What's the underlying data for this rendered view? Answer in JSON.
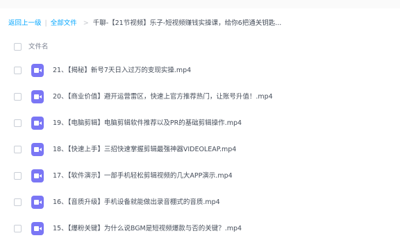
{
  "breadcrumb": {
    "back": "返回上一级",
    "separator": "|",
    "all_files": "全部文件",
    "arrow": ">",
    "current": "千聊-【21节视频】乐子-短视频赚钱实操课，给你6把通关钥匙..."
  },
  "list_header": {
    "column_name": "文件名"
  },
  "files": [
    {
      "name": "21、【揭秘】新号7天日入过万的变现实操.mp4",
      "icon": "video-file-icon"
    },
    {
      "name": "20、【商业价值】避开运营雷区，快速上官方推荐热门，让账号升值！.mp4",
      "icon": "video-file-icon"
    },
    {
      "name": "19、【电脑剪辑】电脑剪辑软件推荐以及PR的基础剪辑操作.mp4",
      "icon": "video-file-icon"
    },
    {
      "name": "18、【快速上手】三招快速掌握剪辑最强神器VIDEOLEAP.mp4",
      "icon": "video-file-icon"
    },
    {
      "name": "17、【软件演示】一部手机轻松剪辑视频的几大APP演示.mp4",
      "icon": "video-file-icon"
    },
    {
      "name": "16、【音质升级】手机设备就能做出录音棚式的音质.mp4",
      "icon": "video-file-icon"
    },
    {
      "name": "15、【爆粉关键】为什么说BGM是短视频爆款与否的关键？.mp4",
      "icon": "video-file-icon"
    }
  ],
  "colors": {
    "link": "#06a7ff",
    "video_icon": "#7a76f5",
    "text": "#454d5a"
  }
}
